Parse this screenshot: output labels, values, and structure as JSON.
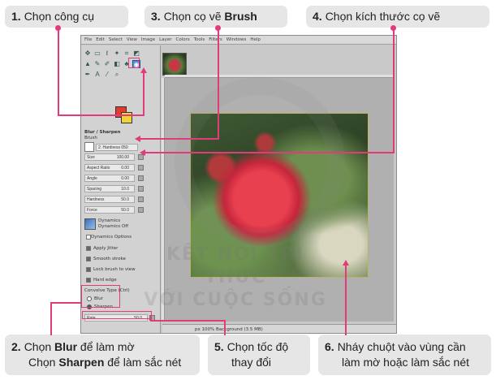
{
  "callouts": {
    "c1": {
      "num": "1.",
      "text": "Chọn công cụ"
    },
    "c3": {
      "num": "3.",
      "text_pre": "Chọn cọ vẽ ",
      "bold": "Brush"
    },
    "c4": {
      "num": "4.",
      "text": "Chọn kích thước cọ vẽ"
    },
    "c2": {
      "num": "2.",
      "line1_pre": "Chọn ",
      "line1_bold": "Blur",
      "line1_post": " để làm mờ",
      "line2_pre": "Chọn ",
      "line2_bold": "Sharpen",
      "line2_post": " để làm sắc nét"
    },
    "c5": {
      "num": "5.",
      "line1": "Chọn tốc độ",
      "line2": "thay đổi"
    },
    "c6": {
      "num": "6.",
      "line1": "Nháy chuột vào vùng cần",
      "line2": "làm mờ hoặc làm sắc nét"
    }
  },
  "gimp": {
    "menu": [
      "File",
      "Edit",
      "Select",
      "View",
      "Image",
      "Layer",
      "Colors",
      "Tools",
      "Filters",
      "Windows",
      "Help"
    ],
    "tool_options": {
      "title": "Blur / Sharpen",
      "brush_label": "Brush",
      "brush_name": "2. Hardness 050",
      "rows": [
        {
          "label": "Size",
          "value": "100.00"
        },
        {
          "label": "Aspect Ratio",
          "value": "0.00"
        },
        {
          "label": "Angle",
          "value": "0.00"
        },
        {
          "label": "Spacing",
          "value": "10.0"
        },
        {
          "label": "Hardness",
          "value": "50.0"
        },
        {
          "label": "Force",
          "value": "50.0"
        }
      ],
      "dynamics_label": "Dynamics",
      "dynamics_value": "Dynamics Off",
      "dynamics_options": "Dynamics Options",
      "checks": [
        "Apply Jitter",
        "Smooth stroke",
        "Lock brush to view",
        "Hard edge"
      ],
      "convolve_type": "Convolve Type (Ctrl)",
      "radio_blur": "Blur",
      "radio_sharpen": "Sharpen",
      "rate_label": "Rate",
      "rate_value": "50.0"
    },
    "status": "px   100%   Background (3.5 MB)"
  },
  "watermark": {
    "line1": "KẾT NỐI TRI THỨC",
    "line2": "VỚI CUỘC SỐNG"
  },
  "colors": {
    "accent": "#e23a7b",
    "fg": "#e03b2c",
    "bg": "#f1d23a"
  }
}
